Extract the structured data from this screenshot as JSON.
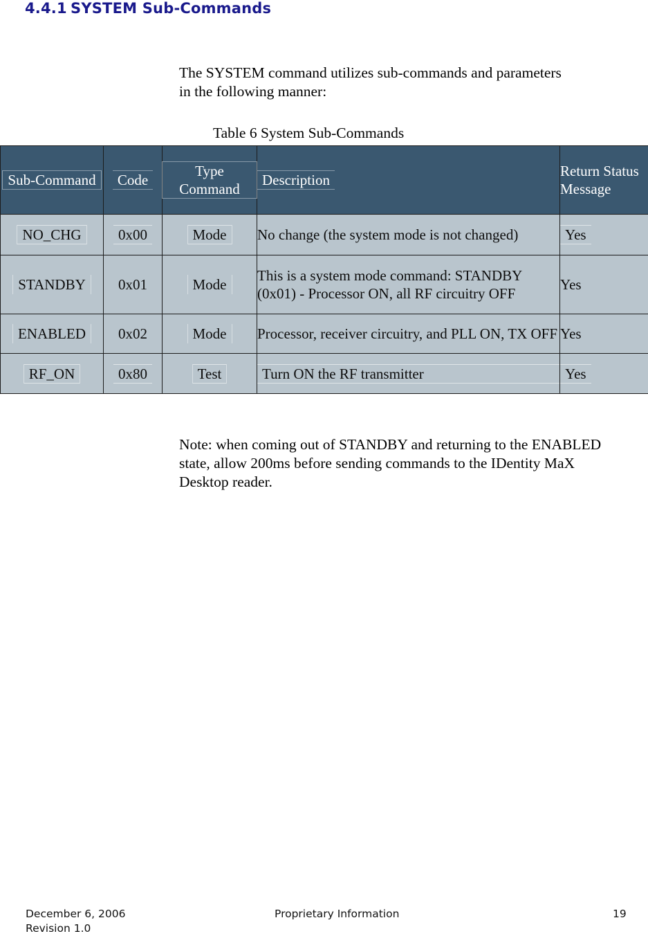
{
  "heading": {
    "number": "4.4.1",
    "title": "SYSTEM Sub-Commands",
    "color": "#1a1a8c"
  },
  "intro_paragraph": "The SYSTEM command utilizes sub-commands and parameters in the following manner:",
  "table_caption": "Table 6 System Sub-Commands",
  "table": {
    "header_bg": "#3a5870",
    "body_bg": "#b9c5cd",
    "columns": [
      {
        "label": "Sub-Command",
        "align": "center"
      },
      {
        "label": "Code",
        "align": "center"
      },
      {
        "label": "Type Command",
        "align": "center"
      },
      {
        "label": "Description",
        "align": "left"
      },
      {
        "label": "Return Status Message",
        "align": "left"
      }
    ],
    "rows": [
      {
        "sub_command": "NO_CHG",
        "code": "0x00",
        "type_command": "Mode",
        "description": "No change (the system mode is not changed)",
        "return_status_message": "Yes"
      },
      {
        "sub_command": "STANDBY",
        "code": "0x01",
        "type_command": "Mode",
        "description": "This is a system mode command: STANDBY (0x01) - Processor ON, all RF circuitry OFF",
        "return_status_message": "Yes"
      },
      {
        "sub_command": "ENABLED",
        "code": "0x02",
        "type_command": "Mode",
        "description": "Processor, receiver circuitry, and PLL ON, TX OFF",
        "return_status_message": "Yes"
      },
      {
        "sub_command": "RF_ON",
        "code": "0x80",
        "type_command": "Test",
        "description": "Turn ON the RF transmitter",
        "return_status_message": "Yes"
      }
    ]
  },
  "note_paragraph": "Note: when coming out of STANDBY and returning to the ENABLED state, allow 200ms before sending commands to the IDentity MaX Desktop reader.",
  "footer": {
    "date": "December 6, 2006",
    "revision": "Revision 1.0",
    "center": "Proprietary Information",
    "page_number": "19"
  }
}
